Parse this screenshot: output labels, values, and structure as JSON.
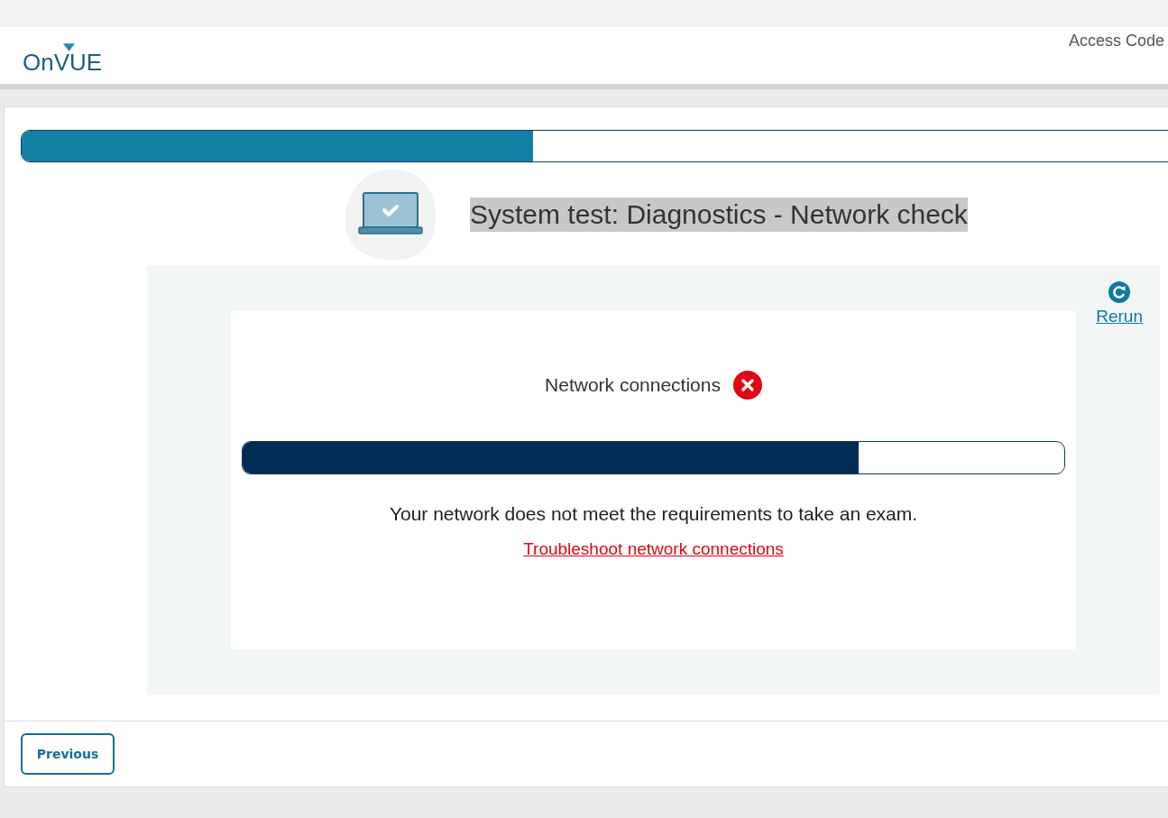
{
  "header": {
    "logo": "OnVUE",
    "access_code": "Access Code"
  },
  "progress": {
    "level": 0.44
  },
  "title": "System test: Diagnostics - Network check",
  "check": {
    "label": "Network connections",
    "failed": true,
    "level": 0.75,
    "message": "Your network does not meet the requirements to take an exam.",
    "link": "Troubleshoot network connections"
  },
  "rerun": "Rerun",
  "buttons": [
    {
      "label": "Previous"
    }
  ]
}
